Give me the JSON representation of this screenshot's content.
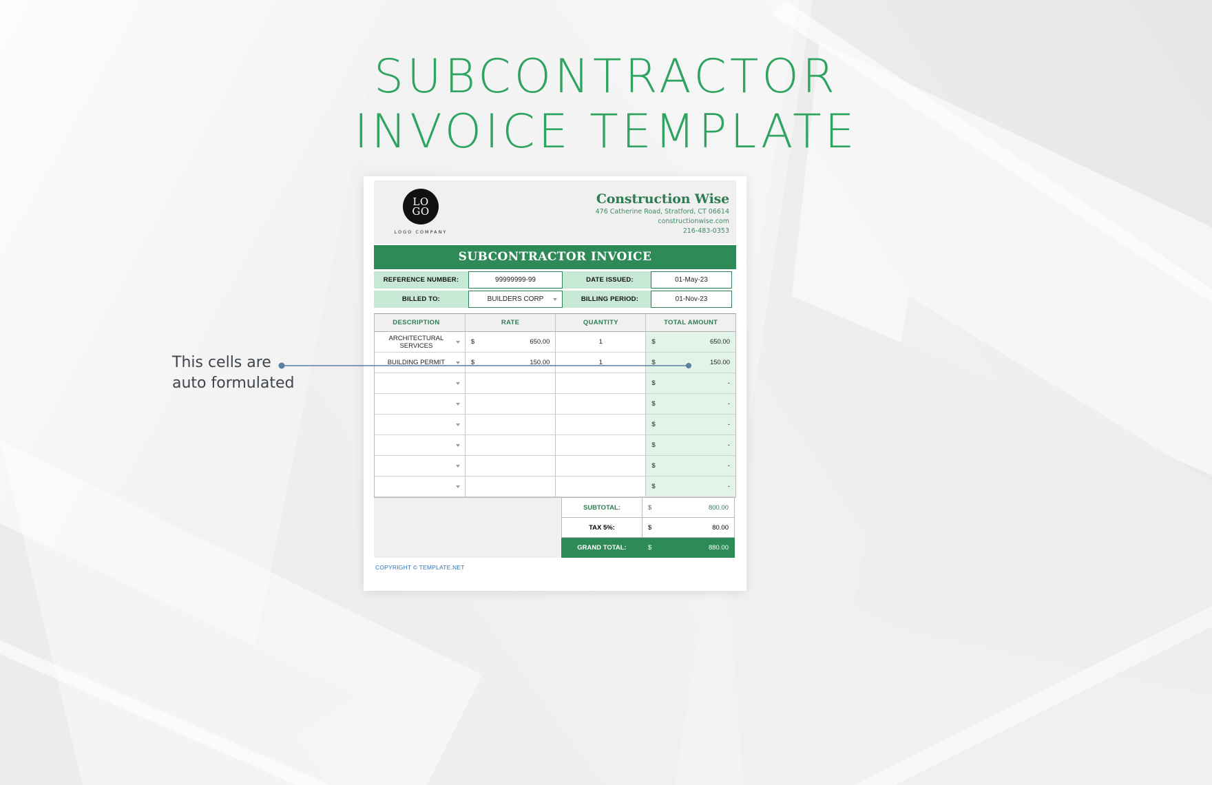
{
  "page": {
    "title_line1": "SUBCONTRACTOR",
    "title_line2": "INVOICE TEMPLATE",
    "title_color": "#2fa360",
    "accent_green": "#2e8b57",
    "mint": "#c6e8d4",
    "amount_cell_bg": "#e2f3e9"
  },
  "annotation": {
    "line1": "This cells are",
    "line2": "auto formulated",
    "color": "#3e444b",
    "leader_color": "#5b7f9e"
  },
  "invoice": {
    "logo": {
      "top": "LO",
      "bottom": "GO",
      "caption": "LOGO COMPANY"
    },
    "company": {
      "name": "Construction Wise",
      "address": "476 Catherine Road, Stratford, CT 06614",
      "website": "constructionwise.com",
      "phone": "216-483-0353"
    },
    "banner": "SUBCONTRACTOR INVOICE",
    "fields": {
      "reference_label": "REFERENCE NUMBER:",
      "reference_value": "99999999-99",
      "date_issued_label": "DATE ISSUED:",
      "date_issued_value": "01-May-23",
      "billed_to_label": "BILLED TO:",
      "billed_to_value": "BUILDERS CORP",
      "billing_period_label": "BILLING PERIOD:",
      "billing_period_value": "01-Nov-23"
    },
    "table": {
      "headers": [
        "DESCRIPTION",
        "RATE",
        "QUANTITY",
        "TOTAL AMOUNT"
      ],
      "rows": [
        {
          "description": "ARCHITECTURAL SERVICES",
          "rate_currency": "$",
          "rate": "650.00",
          "quantity": "1",
          "amount_currency": "$",
          "amount": "650.00"
        },
        {
          "description": "BUILDING PERMIT",
          "rate_currency": "$",
          "rate": "150.00",
          "quantity": "1",
          "amount_currency": "$",
          "amount": "150.00"
        },
        {
          "description": "",
          "rate_currency": "",
          "rate": "",
          "quantity": "",
          "amount_currency": "$",
          "amount": "-"
        },
        {
          "description": "",
          "rate_currency": "",
          "rate": "",
          "quantity": "",
          "amount_currency": "$",
          "amount": "-"
        },
        {
          "description": "",
          "rate_currency": "",
          "rate": "",
          "quantity": "",
          "amount_currency": "$",
          "amount": "-"
        },
        {
          "description": "",
          "rate_currency": "",
          "rate": "",
          "quantity": "",
          "amount_currency": "$",
          "amount": "-"
        },
        {
          "description": "",
          "rate_currency": "",
          "rate": "",
          "quantity": "",
          "amount_currency": "$",
          "amount": "-"
        },
        {
          "description": "",
          "rate_currency": "",
          "rate": "",
          "quantity": "",
          "amount_currency": "$",
          "amount": "-"
        }
      ]
    },
    "totals": [
      {
        "label": "SUBTOTAL:",
        "currency": "$",
        "value": "800.00",
        "style": "green"
      },
      {
        "label": "TAX 5%:",
        "currency": "$",
        "value": "80.00",
        "style": "plain"
      },
      {
        "label": "GRAND TOTAL:",
        "currency": "$",
        "value": "880.00",
        "style": "grand"
      }
    ],
    "copyright": "COPYRIGHT © TEMPLATE.NET"
  }
}
